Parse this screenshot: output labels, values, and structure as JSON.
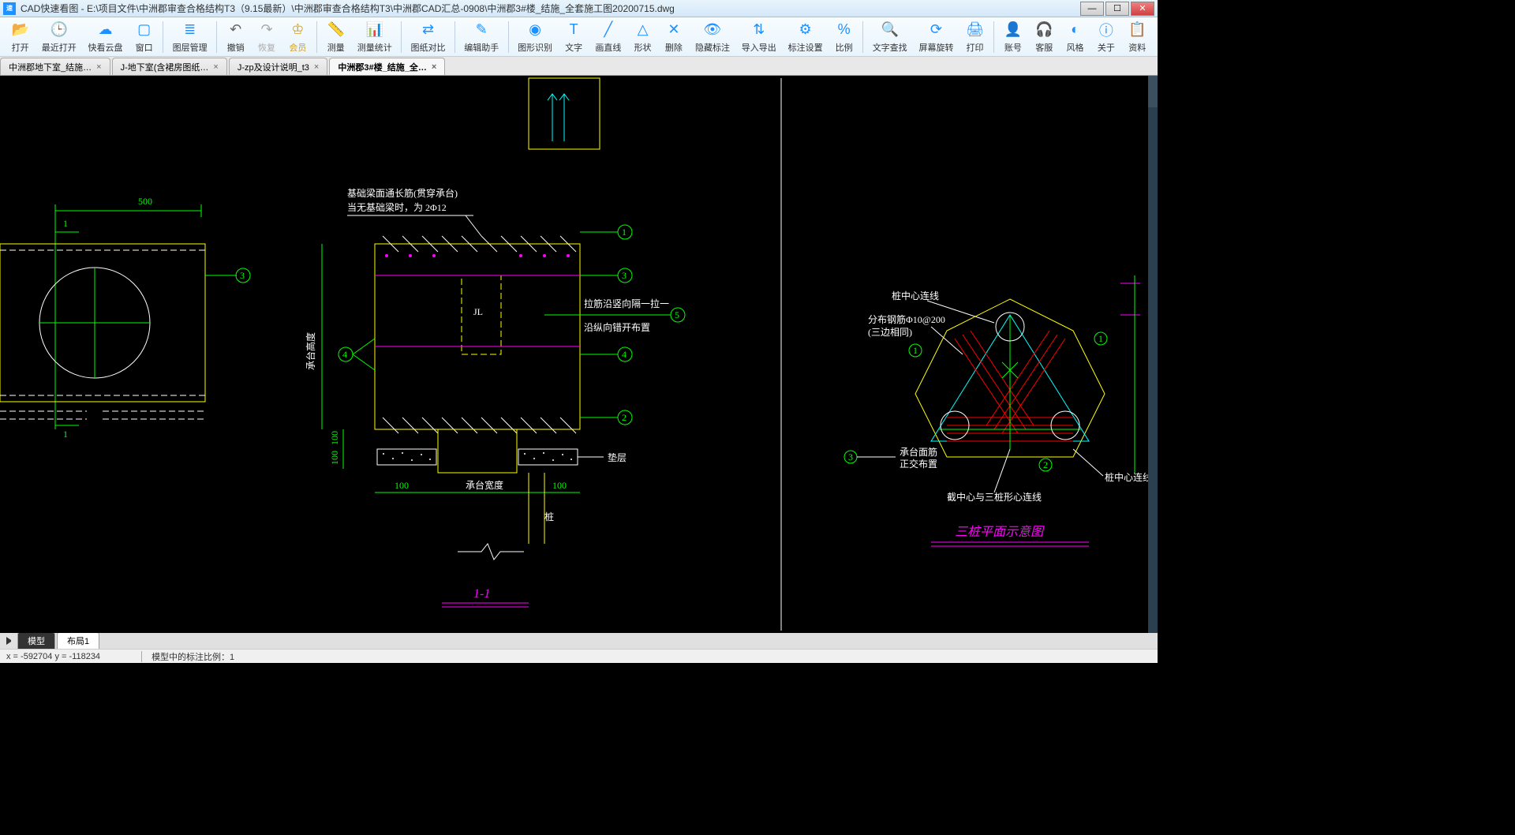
{
  "window": {
    "app_prefix": "CAD快速看图",
    "title": "CAD快速看图 - E:\\项目文件\\中洲郡审查合格结构T3（9.15最新）\\中洲郡审查合格结构T3\\中洲郡CAD汇总-0908\\中洲郡3#楼_结施_全套施工图20200715.dwg"
  },
  "winbtns": {
    "min": "—",
    "max": "☐",
    "close": "✕"
  },
  "toolbar": {
    "groups": [
      [
        "open",
        "打开",
        "#1e90ff",
        "📂"
      ],
      [
        "recent",
        "最近打开",
        "#1e90ff",
        "🕒"
      ],
      [
        "cloud",
        "快看云盘",
        "#1e90ff",
        "☁"
      ],
      [
        "window",
        "窗口",
        "#1e90ff",
        "▢"
      ],
      null,
      [
        "layer",
        "图层管理",
        "#1e90ff",
        "≣"
      ],
      null,
      [
        "undo",
        "撤销",
        "#666",
        "↶"
      ],
      [
        "redo",
        "恢复",
        "#aaa",
        "↷"
      ],
      [
        "vip",
        "会员",
        "#d4a020",
        "♔"
      ],
      null,
      [
        "measure",
        "测量",
        "#1e90ff",
        "📏"
      ],
      [
        "stat",
        "测量统计",
        "#1e90ff",
        "📊"
      ],
      null,
      [
        "compare",
        "图纸对比",
        "#1e90ff",
        "⇄"
      ],
      null,
      [
        "helper",
        "编辑助手",
        "#1e90ff",
        "✎"
      ],
      null,
      [
        "recog",
        "图形识别",
        "#1e90ff",
        "◉"
      ],
      [
        "text",
        "文字",
        "#1e90ff",
        "T"
      ],
      [
        "line",
        "画直线",
        "#1e90ff",
        "╱"
      ],
      [
        "shape",
        "形状",
        "#1e90ff",
        "△"
      ],
      [
        "delete",
        "删除",
        "#1e90ff",
        "✕"
      ],
      [
        "hide",
        "隐藏标注",
        "#1e90ff",
        "👁"
      ],
      [
        "io",
        "导入导出",
        "#1e90ff",
        "⇅"
      ],
      [
        "annoset",
        "标注设置",
        "#1e90ff",
        "⚙"
      ],
      [
        "scale",
        "比例",
        "#1e90ff",
        "%"
      ],
      null,
      [
        "find",
        "文字查找",
        "#1e90ff",
        "🔍"
      ],
      [
        "rotate",
        "屏幕旋转",
        "#1e90ff",
        "⟳"
      ],
      [
        "print",
        "打印",
        "#1e90ff",
        "🖨"
      ],
      null,
      [
        "account",
        "账号",
        "#1e90ff",
        "👤"
      ],
      [
        "service",
        "客服",
        "#1e90ff",
        "🎧"
      ],
      [
        "style",
        "风格",
        "#1e90ff",
        "◐"
      ],
      [
        "about",
        "关于",
        "#1e90ff",
        "ⓘ"
      ],
      [
        "data",
        "资料",
        "#1e90ff",
        "📋"
      ]
    ]
  },
  "tabs": [
    {
      "label": "中洲郡地下室_结施…",
      "active": false
    },
    {
      "label": "J-地下室(含裙房图纸…",
      "active": false
    },
    {
      "label": "J-zp及设计说明_t3",
      "active": false
    },
    {
      "label": "中洲郡3#楼_结施_全…",
      "active": true
    }
  ],
  "drawing": {
    "dim500": "500",
    "dim1a": "1",
    "dim1b": "1",
    "note_top1": "基础梁面通长筋(贯穿承台)",
    "note_top2": "当无基础梁时，为 2Φ12",
    "note_r1": "拉筋沿竖向隔一拉一",
    "note_r2": "沿纵向错开布置",
    "label_h": "承台高度",
    "label_w": "承台宽度",
    "d100a": "100",
    "d100b": "100",
    "d100c": "100",
    "d100d": "100",
    "bed": "垫层",
    "pile": "桩",
    "sec": "1-1",
    "bub1": "1",
    "bub2": "2",
    "bub3": "3",
    "bub3b": "3",
    "bub4": "4",
    "bub4b": "4",
    "bub5": "5",
    "tri_title": "三桩平面示意图",
    "tri_n1": "桩中心连线",
    "tri_n2": "分布钢筋Φ10@200",
    "tri_n3": "(三边相同)",
    "tri_n4": "承台面筋",
    "tri_n5": "正交布置",
    "tri_n6": "桩中心连线",
    "tri_n7": "截中心与三桩形心连线",
    "tri_b1": "1",
    "tri_b2": "2",
    "tri_b3": "3",
    "jl": "JL"
  },
  "bottom": {
    "model": "模型",
    "layout": "布局1"
  },
  "status": {
    "coord": "x = -592704  y = -118234",
    "scale": "模型中的标注比例：1"
  }
}
